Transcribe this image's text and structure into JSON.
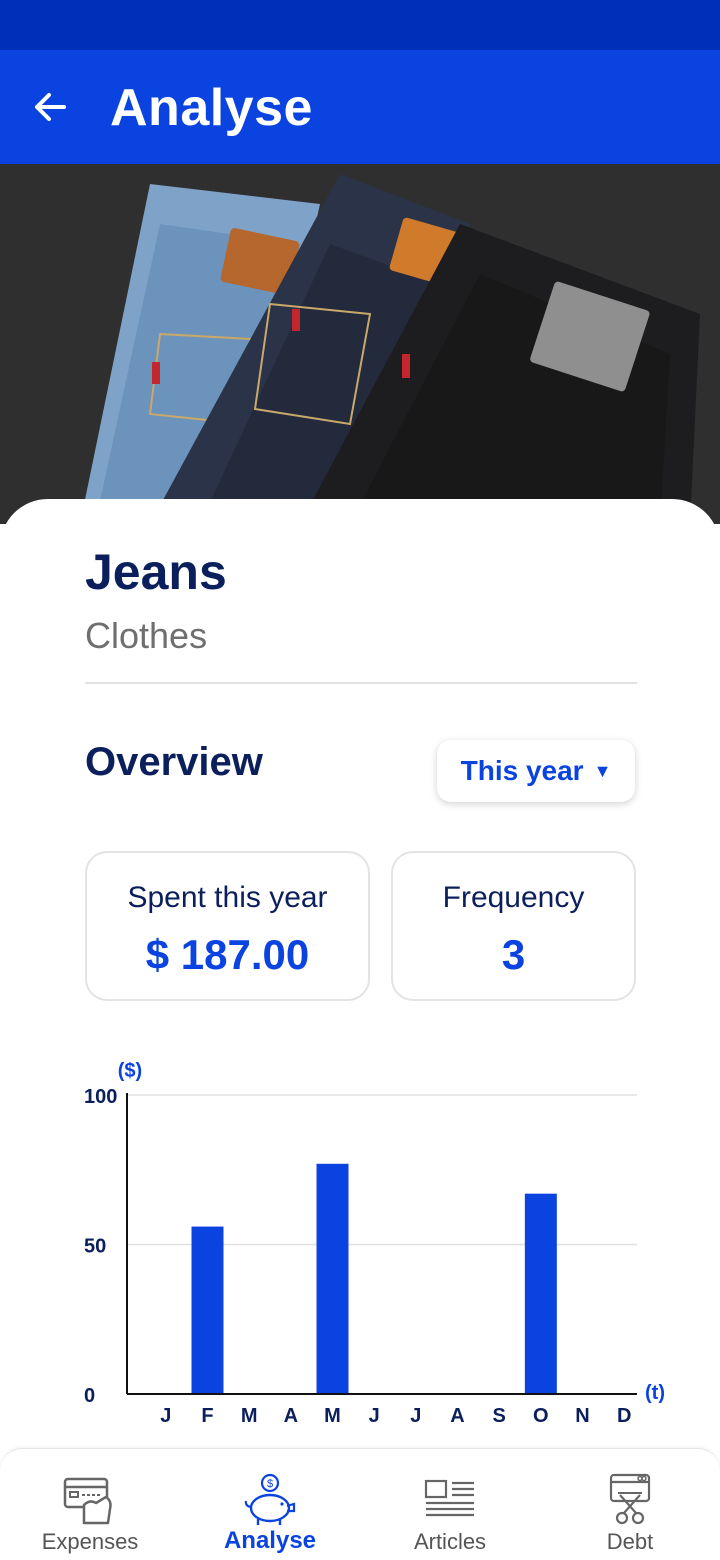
{
  "app_bar": {
    "title": "Analyse"
  },
  "product": {
    "name": "Jeans",
    "category": "Clothes"
  },
  "overview": {
    "title": "Overview",
    "period": "This year",
    "stats": {
      "spent_label": "Spent this year",
      "spent_value": "$ 187.00",
      "frequency_label": "Frequency",
      "frequency_value": "3"
    }
  },
  "chart_data": {
    "type": "bar",
    "ylabel": "($)",
    "xlabel": "(t)",
    "ylim": [
      0,
      100
    ],
    "yticks": [
      "100",
      "50",
      "0"
    ],
    "categories": [
      "J",
      "F",
      "M",
      "A",
      "M",
      "J",
      "J",
      "A",
      "S",
      "O",
      "N",
      "D"
    ],
    "values": [
      0,
      56,
      0,
      0,
      77,
      0,
      0,
      0,
      0,
      67,
      0,
      0
    ],
    "grid": true,
    "bar_color": "#0b43e0"
  },
  "bottom_nav": {
    "items": [
      {
        "label": "Expenses",
        "icon": "expenses-card-icon"
      },
      {
        "label": "Analyse",
        "icon": "piggy-bank-icon",
        "active": true
      },
      {
        "label": "Articles",
        "icon": "articles-icon"
      },
      {
        "label": "Debt",
        "icon": "debt-scissors-card-icon"
      }
    ]
  },
  "colors": {
    "primary": "#0b43e0",
    "status_bar": "#0030b8",
    "heading": "#0b1f5c"
  }
}
